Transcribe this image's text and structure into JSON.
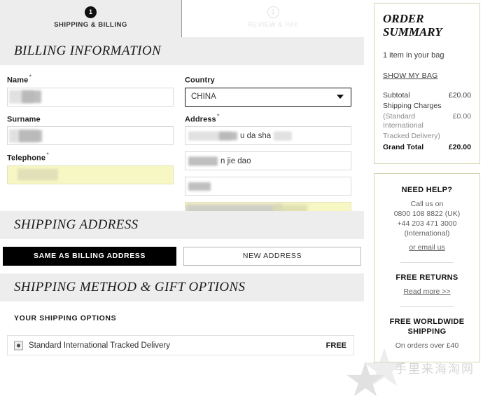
{
  "steps": [
    {
      "number": "1",
      "label": "SHIPPING & BILLING",
      "state": "active"
    },
    {
      "number": "2",
      "label": "REVIEW & PAY",
      "state": "inactive"
    }
  ],
  "sections": {
    "billing": "BILLING INFORMATION",
    "shipping_address": "SHIPPING ADDRESS",
    "shipping_method": "SHIPPING METHOD & GIFT OPTIONS"
  },
  "billing_form": {
    "name": {
      "label": "Name",
      "required": "*",
      "value": ""
    },
    "surname": {
      "label": "Surname",
      "required": "",
      "value": ""
    },
    "telephone": {
      "label": "Telephone",
      "required": "*",
      "value": ""
    },
    "country": {
      "label": "Country",
      "required": "",
      "value": "CHINA"
    },
    "address": {
      "label": "Address",
      "required": "*",
      "line1": "u da sha",
      "line2": "n jie dao",
      "line3": "",
      "line4": ""
    }
  },
  "shipping_address_buttons": {
    "same_as_billing": "SAME AS BILLING ADDRESS",
    "new_address": "NEW ADDRESS"
  },
  "shipping_method": {
    "options_heading": "YOUR SHIPPING OPTIONS",
    "selected_option": "Standard International Tracked Delivery",
    "selected_price": "FREE"
  },
  "order_summary": {
    "title": "ORDER SUMMARY",
    "bag_count": "1 item in your bag",
    "show_bag_link": "SHOW MY BAG",
    "rows": [
      {
        "label": "Subtotal",
        "amount": "£20.00",
        "style": "normal"
      },
      {
        "label": "Shipping Charges",
        "amount": "",
        "style": "normal"
      },
      {
        "label": "(Standard International",
        "amount": "£0.00",
        "style": "muted"
      },
      {
        "label": "Tracked Delivery)",
        "amount": "",
        "style": "muted"
      },
      {
        "label": "Grand Total",
        "amount": "£20.00",
        "style": "total"
      }
    ]
  },
  "help_panel": {
    "need_help_title": "NEED HELP?",
    "call_us": "Call us on",
    "phone_uk": "0800 108 8822 (UK)",
    "phone_intl": "+44 203 471 3000",
    "phone_intl_note": "(International)",
    "email_us": "or email us",
    "free_returns_title": "FREE RETURNS",
    "free_returns_link": "Read more >>",
    "free_shipping_title": "FREE WORLDWIDE SHIPPING",
    "free_shipping_note": "On orders over £40"
  },
  "watermark": {
    "text": "手里来海淘网"
  },
  "colors": {
    "band": "#ededed",
    "accent_dark": "#000000",
    "autofill_yellow": "#f7f7c4",
    "panel_border": "#d6d3b0"
  }
}
